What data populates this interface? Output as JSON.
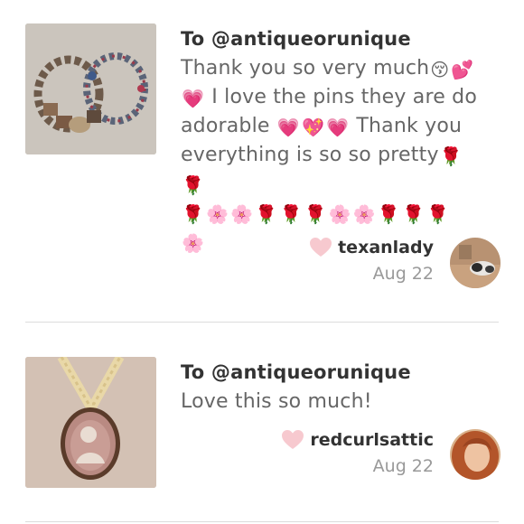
{
  "reviews": [
    {
      "to": "To @antiqueorunique",
      "lines": [
        [
          "Thank you so very much",
          "😚",
          "💕"
        ],
        [
          "💗",
          " I love the pins they are do"
        ],
        [
          "adorable ",
          "💗",
          "💖",
          "💗",
          " Thank you"
        ],
        [
          "everything is so so pretty",
          "🌹",
          " ",
          "🌹"
        ],
        [
          "🌹",
          "🌸",
          "🌸",
          "🌹",
          "🌹",
          "🌹",
          "🌸",
          "🌸",
          "🌹",
          "🌹",
          "🌹"
        ],
        [
          "🌸"
        ]
      ],
      "username": "texanlady",
      "date": "Aug 22",
      "thumb_icon": "beaded-bracelets-photo",
      "avatar_icon": "cat-avatar"
    },
    {
      "to": "To @antiqueorunique",
      "lines": [
        [
          "Love this so much!"
        ]
      ],
      "username": "redcurlsattic",
      "date": "Aug 22",
      "thumb_icon": "cameo-pendant-photo",
      "avatar_icon": "red-hair-avatar"
    }
  ],
  "colors": {
    "heart": "#f7c9cf",
    "username": "#333333",
    "date": "#999999",
    "message": "#666666",
    "divider": "#dcdcdc"
  }
}
